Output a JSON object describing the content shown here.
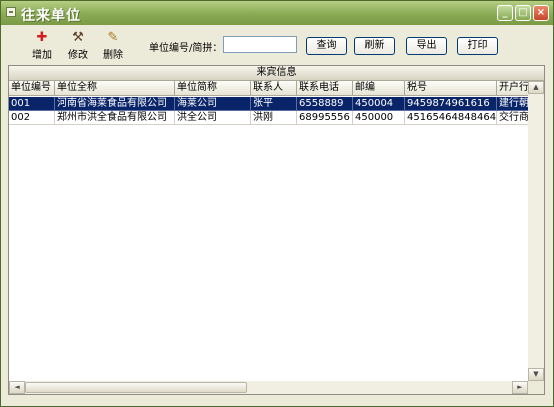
{
  "window": {
    "title": "往来单位"
  },
  "caption_buttons": {
    "minimize": "_",
    "maximize": "□",
    "close": "×"
  },
  "toolbar": {
    "add_label": "增加",
    "add_icon": "add-plus-icon",
    "edit_label": "修改",
    "edit_icon": "hammer-icon",
    "delete_label": "删除",
    "delete_icon": "broom-icon"
  },
  "search": {
    "label": "单位编号/简拼：",
    "value": "",
    "placeholder": ""
  },
  "buttons": {
    "query": "查询",
    "refresh": "刷新",
    "export": "导出",
    "print": "打印"
  },
  "panel": {
    "title": "来宾信息"
  },
  "table": {
    "columns": [
      "单位编号",
      "单位全称",
      "单位简称",
      "联系人",
      "联系电话",
      "邮编",
      "税号",
      "开户行"
    ],
    "rows": [
      [
        "001",
        "河南省海莱食品有限公司",
        "海莱公司",
        "张平",
        "6558889",
        "450004",
        "9459874961616",
        "建行朝"
      ],
      [
        "002",
        "郑州市洪全食品有限公司",
        "洪全公司",
        "洪刚",
        "68995556",
        "450000",
        "45165464848464",
        "交行商"
      ]
    ],
    "selected_row": 0
  },
  "scrollbars": {
    "up": "▲",
    "down": "▼",
    "left": "◄",
    "right": "►"
  },
  "colors": {
    "selection": "#0a246a",
    "titlebar": "#8aaa55",
    "background": "#ecead8"
  }
}
